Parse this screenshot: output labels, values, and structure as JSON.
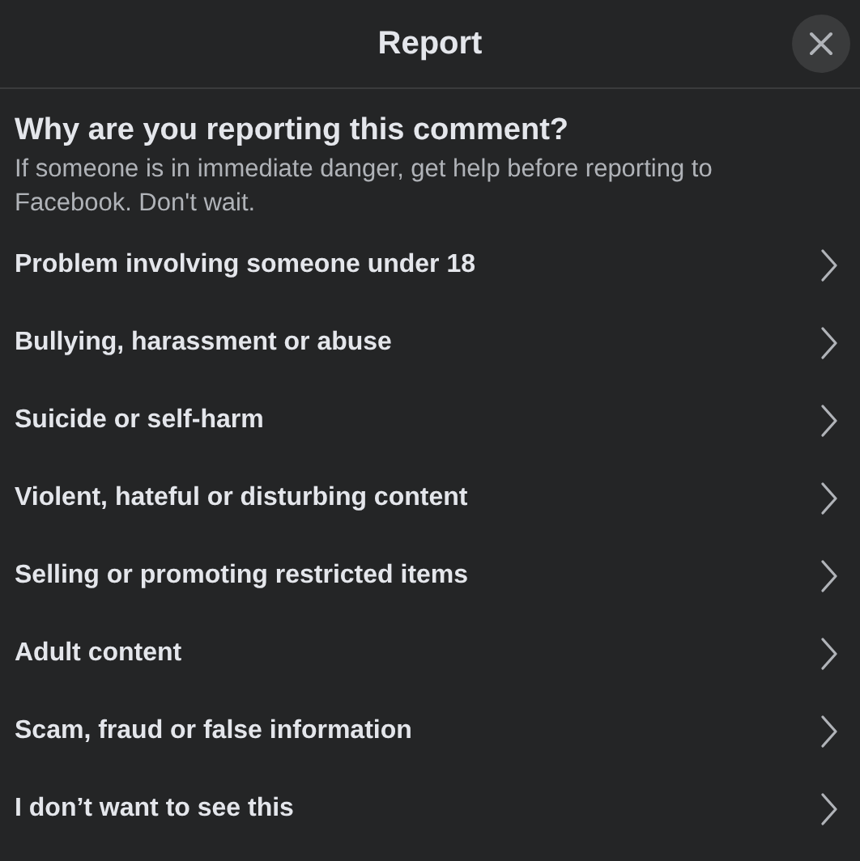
{
  "dialog": {
    "title": "Report"
  },
  "heading": "Why are you reporting this comment?",
  "subtext": "If someone is in immediate danger, get help before reporting to Facebook. Don't wait.",
  "options": [
    {
      "label": "Problem involving someone under 18"
    },
    {
      "label": "Bullying, harassment or abuse"
    },
    {
      "label": "Suicide or self-harm"
    },
    {
      "label": "Violent, hateful or disturbing content"
    },
    {
      "label": "Selling or promoting restricted items"
    },
    {
      "label": "Adult content"
    },
    {
      "label": "Scam, fraud or false information"
    },
    {
      "label": "I don’t want to see this"
    }
  ]
}
